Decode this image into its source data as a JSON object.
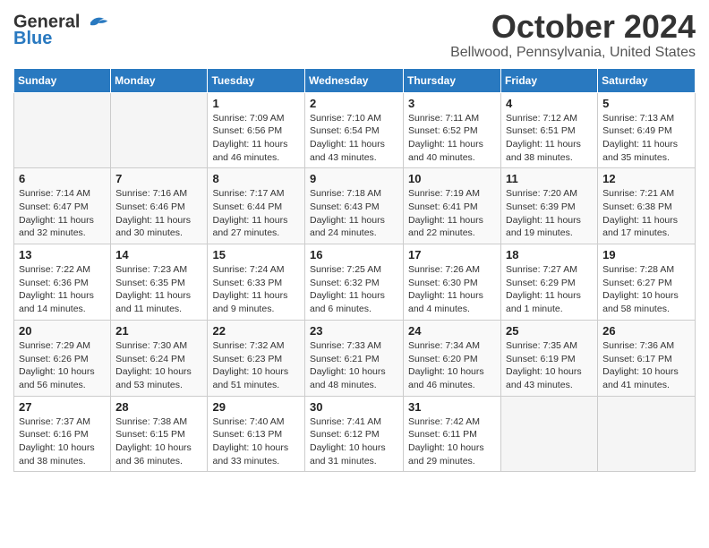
{
  "header": {
    "logo_line1": "General",
    "logo_line2": "Blue",
    "title": "October 2024",
    "subtitle": "Bellwood, Pennsylvania, United States"
  },
  "days_of_week": [
    "Sunday",
    "Monday",
    "Tuesday",
    "Wednesday",
    "Thursday",
    "Friday",
    "Saturday"
  ],
  "weeks": [
    [
      {
        "day": "",
        "empty": true
      },
      {
        "day": "",
        "empty": true
      },
      {
        "day": "1",
        "sunrise": "Sunrise: 7:09 AM",
        "sunset": "Sunset: 6:56 PM",
        "daylight": "Daylight: 11 hours and 46 minutes."
      },
      {
        "day": "2",
        "sunrise": "Sunrise: 7:10 AM",
        "sunset": "Sunset: 6:54 PM",
        "daylight": "Daylight: 11 hours and 43 minutes."
      },
      {
        "day": "3",
        "sunrise": "Sunrise: 7:11 AM",
        "sunset": "Sunset: 6:52 PM",
        "daylight": "Daylight: 11 hours and 40 minutes."
      },
      {
        "day": "4",
        "sunrise": "Sunrise: 7:12 AM",
        "sunset": "Sunset: 6:51 PM",
        "daylight": "Daylight: 11 hours and 38 minutes."
      },
      {
        "day": "5",
        "sunrise": "Sunrise: 7:13 AM",
        "sunset": "Sunset: 6:49 PM",
        "daylight": "Daylight: 11 hours and 35 minutes."
      }
    ],
    [
      {
        "day": "6",
        "sunrise": "Sunrise: 7:14 AM",
        "sunset": "Sunset: 6:47 PM",
        "daylight": "Daylight: 11 hours and 32 minutes."
      },
      {
        "day": "7",
        "sunrise": "Sunrise: 7:16 AM",
        "sunset": "Sunset: 6:46 PM",
        "daylight": "Daylight: 11 hours and 30 minutes."
      },
      {
        "day": "8",
        "sunrise": "Sunrise: 7:17 AM",
        "sunset": "Sunset: 6:44 PM",
        "daylight": "Daylight: 11 hours and 27 minutes."
      },
      {
        "day": "9",
        "sunrise": "Sunrise: 7:18 AM",
        "sunset": "Sunset: 6:43 PM",
        "daylight": "Daylight: 11 hours and 24 minutes."
      },
      {
        "day": "10",
        "sunrise": "Sunrise: 7:19 AM",
        "sunset": "Sunset: 6:41 PM",
        "daylight": "Daylight: 11 hours and 22 minutes."
      },
      {
        "day": "11",
        "sunrise": "Sunrise: 7:20 AM",
        "sunset": "Sunset: 6:39 PM",
        "daylight": "Daylight: 11 hours and 19 minutes."
      },
      {
        "day": "12",
        "sunrise": "Sunrise: 7:21 AM",
        "sunset": "Sunset: 6:38 PM",
        "daylight": "Daylight: 11 hours and 17 minutes."
      }
    ],
    [
      {
        "day": "13",
        "sunrise": "Sunrise: 7:22 AM",
        "sunset": "Sunset: 6:36 PM",
        "daylight": "Daylight: 11 hours and 14 minutes."
      },
      {
        "day": "14",
        "sunrise": "Sunrise: 7:23 AM",
        "sunset": "Sunset: 6:35 PM",
        "daylight": "Daylight: 11 hours and 11 minutes."
      },
      {
        "day": "15",
        "sunrise": "Sunrise: 7:24 AM",
        "sunset": "Sunset: 6:33 PM",
        "daylight": "Daylight: 11 hours and 9 minutes."
      },
      {
        "day": "16",
        "sunrise": "Sunrise: 7:25 AM",
        "sunset": "Sunset: 6:32 PM",
        "daylight": "Daylight: 11 hours and 6 minutes."
      },
      {
        "day": "17",
        "sunrise": "Sunrise: 7:26 AM",
        "sunset": "Sunset: 6:30 PM",
        "daylight": "Daylight: 11 hours and 4 minutes."
      },
      {
        "day": "18",
        "sunrise": "Sunrise: 7:27 AM",
        "sunset": "Sunset: 6:29 PM",
        "daylight": "Daylight: 11 hours and 1 minute."
      },
      {
        "day": "19",
        "sunrise": "Sunrise: 7:28 AM",
        "sunset": "Sunset: 6:27 PM",
        "daylight": "Daylight: 10 hours and 58 minutes."
      }
    ],
    [
      {
        "day": "20",
        "sunrise": "Sunrise: 7:29 AM",
        "sunset": "Sunset: 6:26 PM",
        "daylight": "Daylight: 10 hours and 56 minutes."
      },
      {
        "day": "21",
        "sunrise": "Sunrise: 7:30 AM",
        "sunset": "Sunset: 6:24 PM",
        "daylight": "Daylight: 10 hours and 53 minutes."
      },
      {
        "day": "22",
        "sunrise": "Sunrise: 7:32 AM",
        "sunset": "Sunset: 6:23 PM",
        "daylight": "Daylight: 10 hours and 51 minutes."
      },
      {
        "day": "23",
        "sunrise": "Sunrise: 7:33 AM",
        "sunset": "Sunset: 6:21 PM",
        "daylight": "Daylight: 10 hours and 48 minutes."
      },
      {
        "day": "24",
        "sunrise": "Sunrise: 7:34 AM",
        "sunset": "Sunset: 6:20 PM",
        "daylight": "Daylight: 10 hours and 46 minutes."
      },
      {
        "day": "25",
        "sunrise": "Sunrise: 7:35 AM",
        "sunset": "Sunset: 6:19 PM",
        "daylight": "Daylight: 10 hours and 43 minutes."
      },
      {
        "day": "26",
        "sunrise": "Sunrise: 7:36 AM",
        "sunset": "Sunset: 6:17 PM",
        "daylight": "Daylight: 10 hours and 41 minutes."
      }
    ],
    [
      {
        "day": "27",
        "sunrise": "Sunrise: 7:37 AM",
        "sunset": "Sunset: 6:16 PM",
        "daylight": "Daylight: 10 hours and 38 minutes."
      },
      {
        "day": "28",
        "sunrise": "Sunrise: 7:38 AM",
        "sunset": "Sunset: 6:15 PM",
        "daylight": "Daylight: 10 hours and 36 minutes."
      },
      {
        "day": "29",
        "sunrise": "Sunrise: 7:40 AM",
        "sunset": "Sunset: 6:13 PM",
        "daylight": "Daylight: 10 hours and 33 minutes."
      },
      {
        "day": "30",
        "sunrise": "Sunrise: 7:41 AM",
        "sunset": "Sunset: 6:12 PM",
        "daylight": "Daylight: 10 hours and 31 minutes."
      },
      {
        "day": "31",
        "sunrise": "Sunrise: 7:42 AM",
        "sunset": "Sunset: 6:11 PM",
        "daylight": "Daylight: 10 hours and 29 minutes."
      },
      {
        "day": "",
        "empty": true
      },
      {
        "day": "",
        "empty": true
      }
    ]
  ]
}
